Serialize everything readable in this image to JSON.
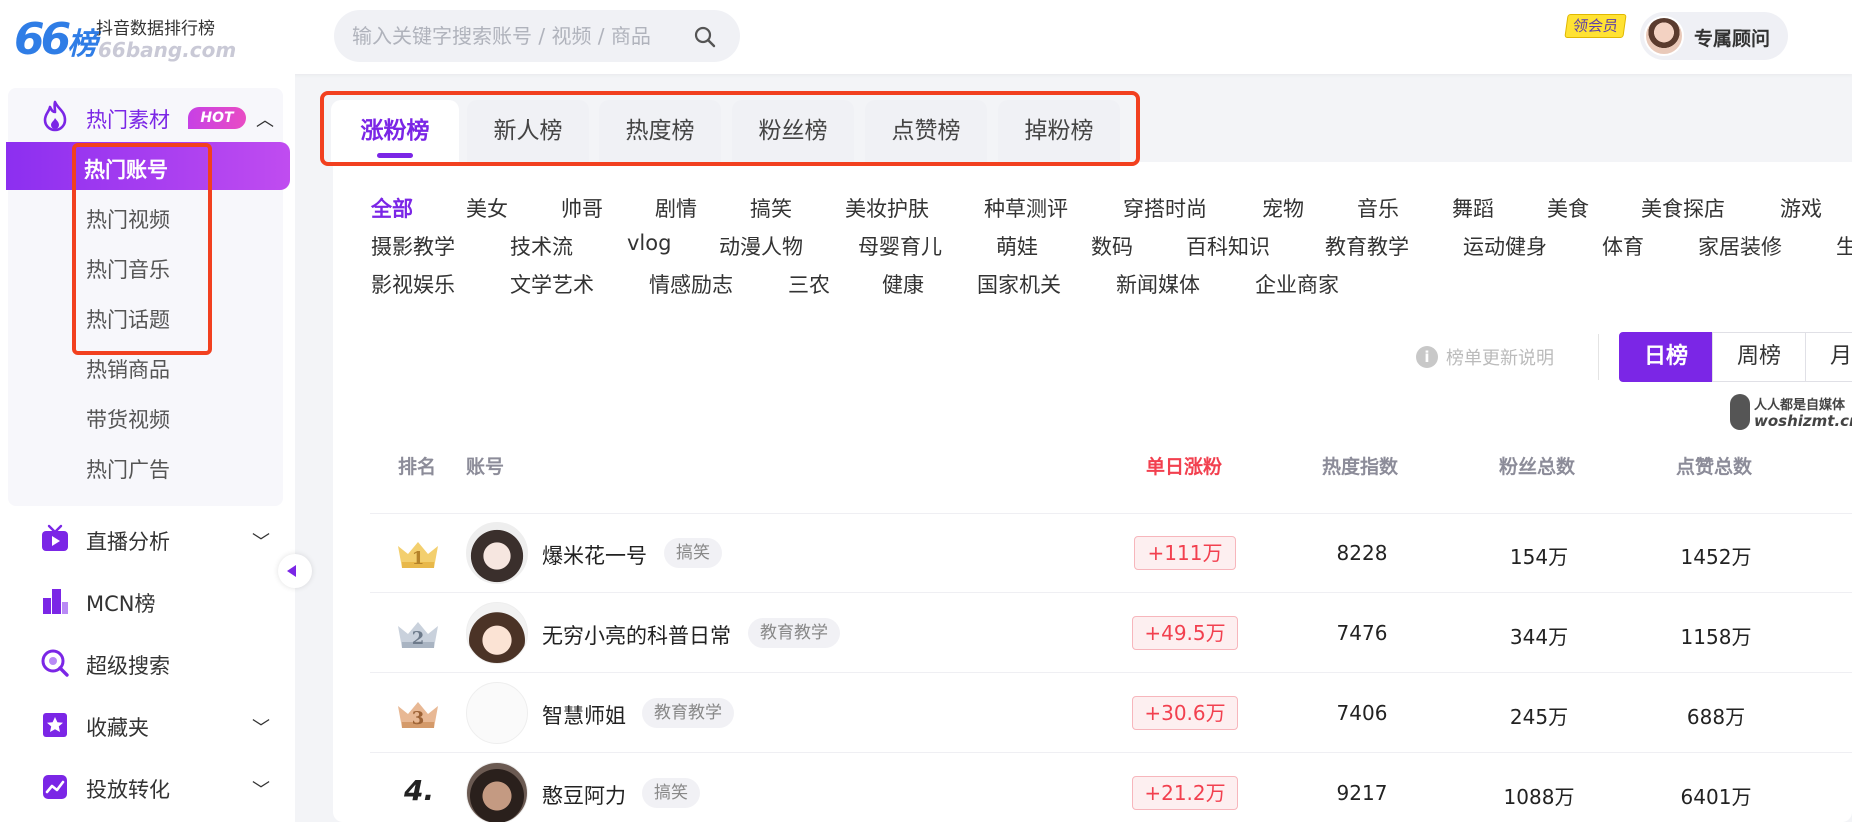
{
  "header": {
    "logo_mark": "66",
    "logo_mark_cn": "榜",
    "logo_title": "抖音数据排行榜",
    "logo_domain": "66bang.com",
    "search_placeholder": "输入关键字搜索账号 / 视频 / 商品",
    "vip_label": "领会员",
    "advisor_label": "专属顾问"
  },
  "sidebar": {
    "group_label": "热门素材",
    "hot_badge": "HOT",
    "sub_items": [
      "热门账号",
      "热门视频",
      "热门音乐",
      "热门话题",
      "热销商品",
      "带货视频",
      "热门广告"
    ],
    "nav_items": [
      "直播分析",
      "MCN榜",
      "超级搜索",
      "收藏夹",
      "投放转化"
    ]
  },
  "tabs": [
    "涨粉榜",
    "新人榜",
    "热度榜",
    "粉丝榜",
    "点赞榜",
    "掉粉榜"
  ],
  "categories": {
    "row1": [
      "全部",
      "美女",
      "帅哥",
      "剧情",
      "搞笑",
      "美妆护肤",
      "种草测评",
      "穿搭时尚",
      "宠物",
      "音乐",
      "舞蹈",
      "美食",
      "美食探店",
      "游戏"
    ],
    "row2": [
      "摄影教学",
      "技术流",
      "vlog",
      "动漫人物",
      "母婴育儿",
      "萌娃",
      "数码",
      "百科知识",
      "教育教学",
      "运动健身",
      "体育",
      "家居装修",
      "生"
    ],
    "row3": [
      "影视娱乐",
      "文学艺术",
      "情感励志",
      "三农",
      "健康",
      "国家机关",
      "新闻媒体",
      "企业商家"
    ]
  },
  "toolbar": {
    "update_note": "榜单更新说明",
    "info_glyph": "i",
    "periods": [
      "日榜",
      "周榜",
      "月"
    ]
  },
  "watermark": {
    "line1": "人人都是自媒体",
    "line2": "woshizmt.cn"
  },
  "table": {
    "headers": [
      "排名",
      "账号",
      "单日涨粉",
      "热度指数",
      "粉丝总数",
      "点赞总数"
    ],
    "rows": [
      {
        "rank": "1",
        "name": "爆米花一号",
        "tag": "搞笑",
        "gain": "+111万",
        "heat": "8228",
        "fans": "154万",
        "likes": "1452万"
      },
      {
        "rank": "2",
        "name": "无穷小亮的科普日常",
        "tag": "教育教学",
        "gain": "+49.5万",
        "heat": "7476",
        "fans": "344万",
        "likes": "1158万"
      },
      {
        "rank": "3",
        "name": "智慧师姐",
        "tag": "教育教学",
        "gain": "+30.6万",
        "heat": "7406",
        "fans": "245万",
        "likes": "688万"
      },
      {
        "rank": "4.",
        "name": "憨豆阿力",
        "tag": "搞笑",
        "gain": "+21.2万",
        "heat": "9217",
        "fans": "1088万",
        "likes": "6401万"
      }
    ]
  },
  "colors": {
    "accent": "#7b26e6",
    "highlight": "#f2401f",
    "gain": "#f2404f",
    "gold": "#e8b84a",
    "silver": "#a9b4c2",
    "bronze": "#d49a6a"
  }
}
